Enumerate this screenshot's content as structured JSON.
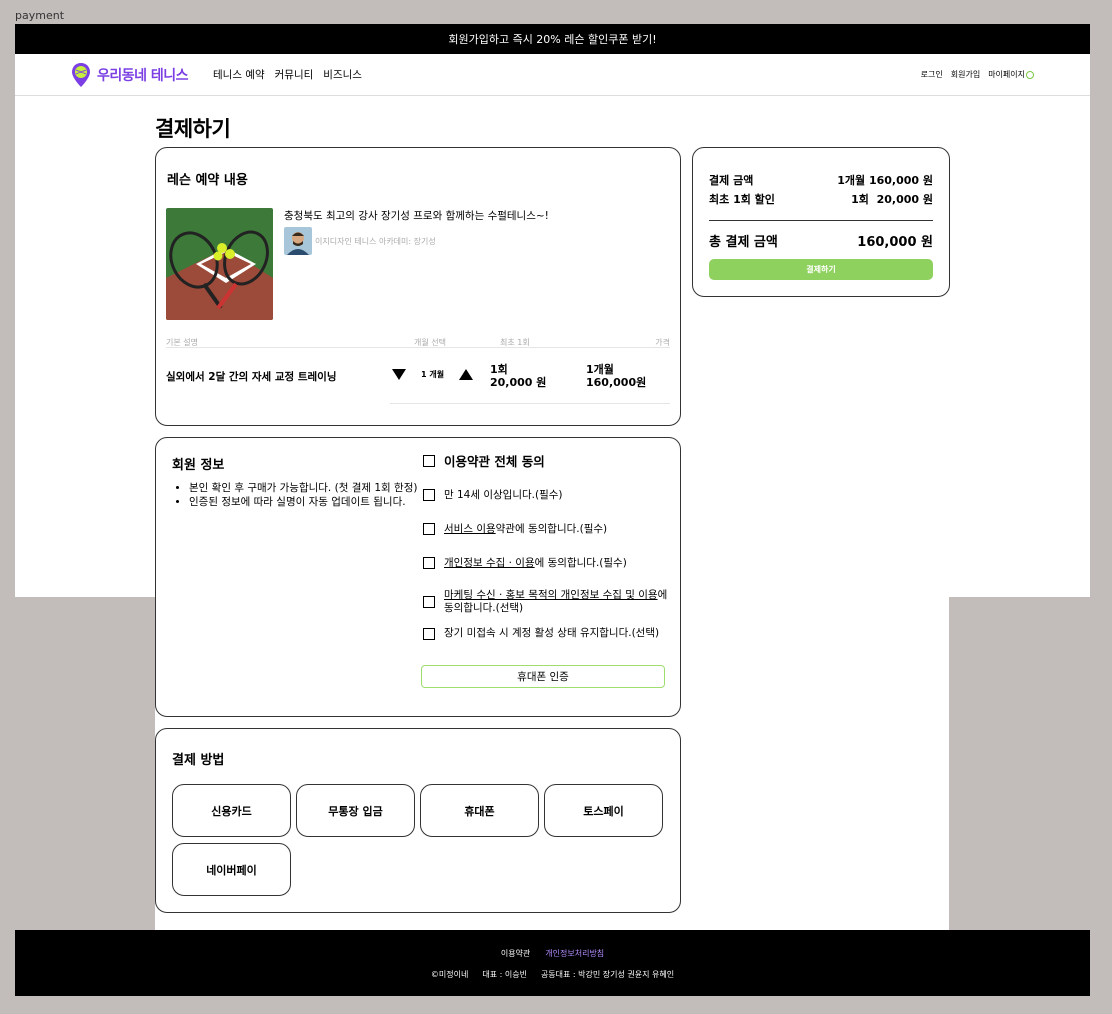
{
  "frame_label": "payment",
  "promo": {
    "text": "회원가입하고 즉시 20% 레슨 할인쿠폰 받기!"
  },
  "header": {
    "logo_text": "우리동네 테니스",
    "nav": [
      "테니스 예약",
      "커뮤니티",
      "비즈니스"
    ],
    "login": "로그인",
    "signup": "회원가입",
    "mypage": "마이페이지"
  },
  "page_title": "결제하기",
  "lesson": {
    "section_title": "레슨 예약 내용",
    "name": "충청북도 최고의 강사 장기성 프로와 함께하는 수펄테니스~!",
    "academy": "이지디자인 테니스 아카데미: 장기성",
    "table_headers": {
      "desc": "기본 설명",
      "month": "개월 선택",
      "first": "최초 1회",
      "price": "가격"
    },
    "row": {
      "desc": "실외에서 2달 간의 자세 교정 트레이닝",
      "month": "1 개월",
      "first_line1": "1회",
      "first_line2": "20,000 원",
      "price_line1": "1개월",
      "price_line2": "160,000원"
    }
  },
  "summary": {
    "pay_amount_label": "결제 금액",
    "pay_amount_value": "1개월 160,000 원",
    "discount_label": "최초 1회 할인",
    "discount_value": "1회  20,000 원",
    "total_label": "총 결제 금액",
    "total_value": "160,000 원",
    "pay_button": "결제하기"
  },
  "member": {
    "section_title": "회원 정보",
    "notes": [
      "본인 확인 후 구매가 가능합니다. (첫 결제 1회 한정)",
      "인증된 정보에 따라 실명이 자동 업데이트 됩니다."
    ],
    "terms_all": "이용약관 전체 동의",
    "term_age": "만 14세 이상입니다.(필수)",
    "term_service_u": "서비스 이용",
    "term_service_rest": "약관에 동의합니다.(필수)",
    "term_privacy_u": "개인정보 수집 · 이용",
    "term_privacy_rest": "에 동의합니다.(필수)",
    "term_marketing_u": "마케팅 수신 · 홍보 목적의 개인정보 수집 및 이용",
    "term_marketing_rest": "에 동의합니다.(선택)",
    "term_dormant": "장기 미접속 시 계정 활성 상태 유지합니다.(선택)",
    "phone_button": "휴대폰 인증"
  },
  "payment": {
    "section_title": "결제 방법",
    "methods": [
      "신용카드",
      "무통장 입금",
      "휴대폰",
      "토스페이",
      "네이버페이"
    ]
  },
  "footer": {
    "terms": "이용약관",
    "privacy": "개인정보처리방침",
    "company": "©미정이네",
    "ceo": "대표 : 이승빈",
    "co_ceo": "공동대표 : 박강민 장기성 권윤지 유혜인"
  },
  "colors": {
    "brand": "#7b3fe4",
    "accent_green": "#8fd15e",
    "privacy_link": "#b18cff"
  }
}
